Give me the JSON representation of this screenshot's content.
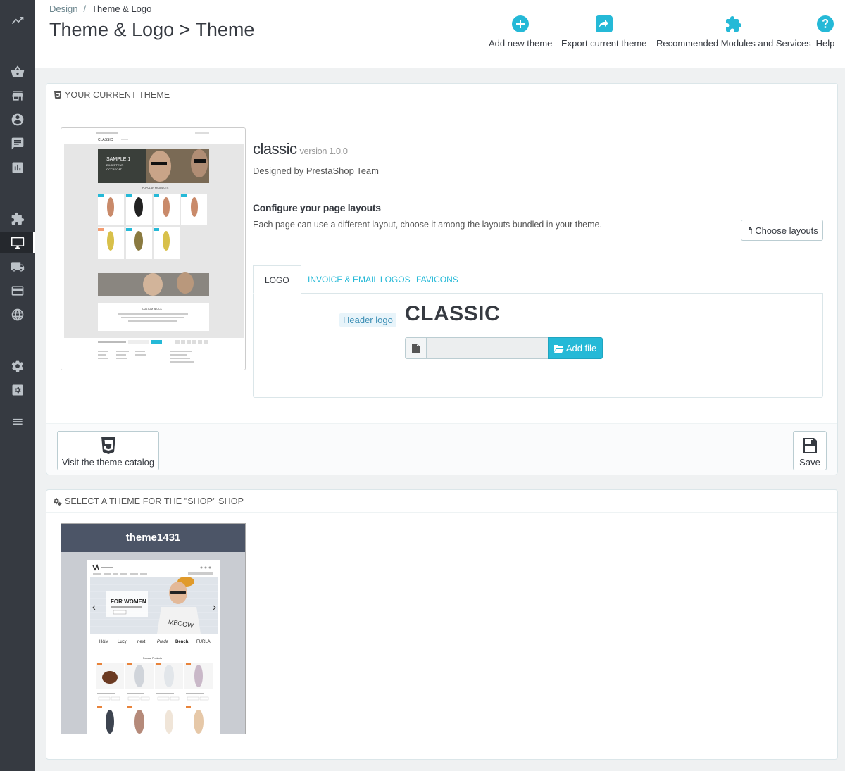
{
  "breadcrumb": {
    "parent": "Design",
    "separator": "/",
    "current": "Theme & Logo"
  },
  "page_title": "Theme & Logo > Theme",
  "toolbar": {
    "add_new_theme": "Add new theme",
    "export_current_theme": "Export current theme",
    "recommended": "Recommended Modules and Services",
    "help": "Help"
  },
  "current_theme_panel": {
    "heading": "Your current theme",
    "theme_name": "classic",
    "version": "version 1.0.0",
    "designed_by": "Designed by PrestaShop Team",
    "configure_title": "Configure your page layouts",
    "configure_desc": "Each page can use a different layout, choose it among the layouts bundled in your theme.",
    "choose_layouts": "Choose layouts",
    "tabs": [
      "Logo",
      "Invoice & Email Logos",
      "Favicons"
    ],
    "header_logo_label": "Header logo",
    "logo_text": "CLASSIC",
    "add_file": "Add file",
    "visit_catalog": "Visit the theme catalog",
    "save": "Save"
  },
  "preview_classic": {
    "brand": "CLASSIC",
    "slide_title": "SAMPLE 1",
    "slide_sub1": "EXCEPTEUR",
    "slide_sub2": "OCCAECAT",
    "popular": "POPULAR PRODUCTS",
    "custom_block": "CUSTOM BLOCK"
  },
  "select_theme_panel": {
    "heading": "Select a theme for the \"shop\" shop",
    "theme_card_name": "theme1431",
    "preview_banner": "FOR WOMEN",
    "preview_shirt": "MEOOW",
    "preview_popular": "Popular Products",
    "preview_brands": [
      "H&M",
      "Lucy",
      "next",
      "Prada",
      "Bench.",
      "FURLA"
    ]
  },
  "colors": {
    "sidebar": "#363a41",
    "accent": "#25b9d7",
    "card_head": "#4c5567"
  }
}
